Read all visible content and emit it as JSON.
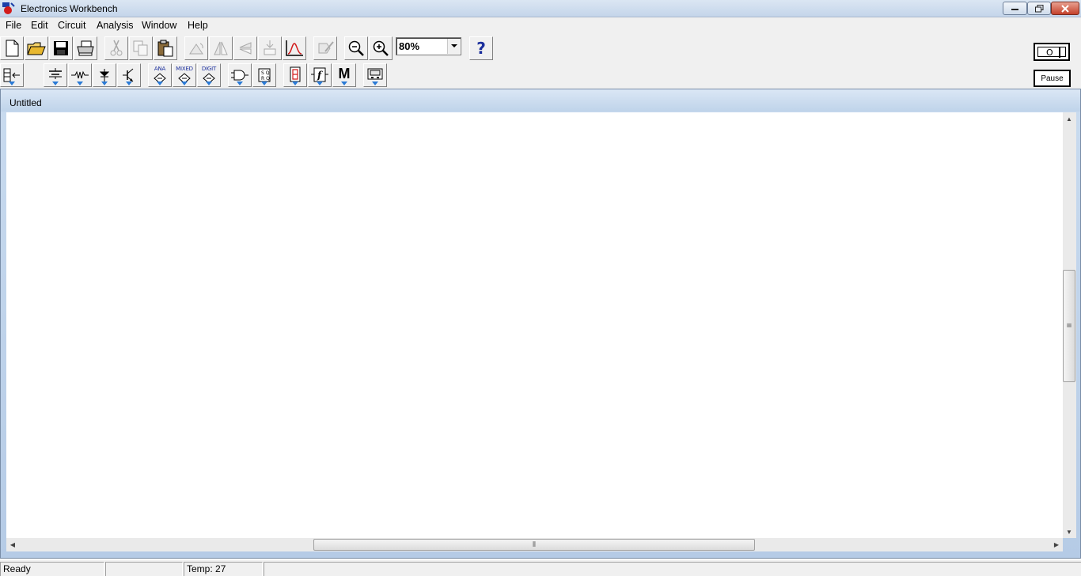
{
  "window": {
    "title": "Electronics Workbench"
  },
  "menu": [
    "File",
    "Edit",
    "Circuit",
    "Analysis",
    "Window",
    "Help"
  ],
  "toolbar": {
    "zoom_value": "80%",
    "help_label": "?",
    "part_labels": {
      "analog": "ANA",
      "mixed": "MIXED",
      "digital": "DIGIT",
      "misc": "M"
    }
  },
  "power": {
    "pause_label": "Pause",
    "switch_off_label": "O"
  },
  "document": {
    "title": "Untitled"
  },
  "status": {
    "message": "Ready",
    "middle": "",
    "temp_label": "Temp:",
    "temp_value": "27"
  },
  "colors": {
    "accent": "#2a7ad6",
    "titlebar": "#c4d5ea",
    "close": "#c4412b"
  }
}
